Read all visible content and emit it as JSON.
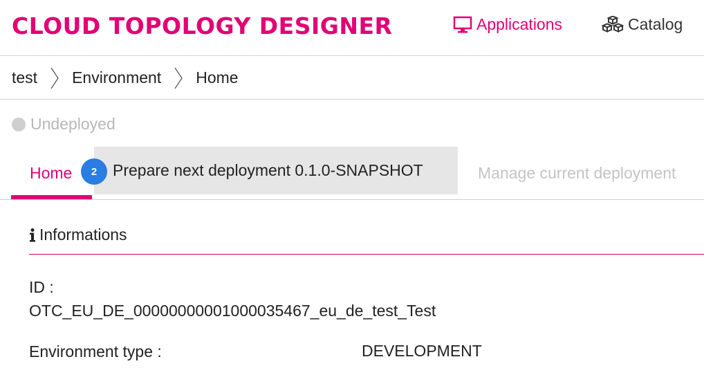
{
  "header": {
    "title": "CLOUD TOPOLOGY DESIGNER",
    "nav": [
      {
        "label": "Applications",
        "icon": "monitor-icon",
        "active": true
      },
      {
        "label": "Catalog",
        "icon": "cubes-icon",
        "active": false
      }
    ]
  },
  "breadcrumb": [
    "test",
    "Environment",
    "Home"
  ],
  "status": {
    "label": "Undeployed",
    "color": "#cfcfcf"
  },
  "tabs": {
    "home": "Home",
    "badge": "2",
    "prepare": "Prepare next deployment 0.1.0-SNAPSHOT",
    "manage": "Manage current deployment"
  },
  "section": {
    "icon": "info-icon",
    "title": "Informations"
  },
  "fields": {
    "id_label": "ID :",
    "id_value": "OTC_EU_DE_00000000001000035467_eu_de_test_Test",
    "env_type_label": "Environment type :",
    "env_type_value": "DEVELOPMENT"
  },
  "colors": {
    "accent": "#e20074",
    "badge": "#2a7de1",
    "tab_highlight": "#e6e6e6"
  }
}
